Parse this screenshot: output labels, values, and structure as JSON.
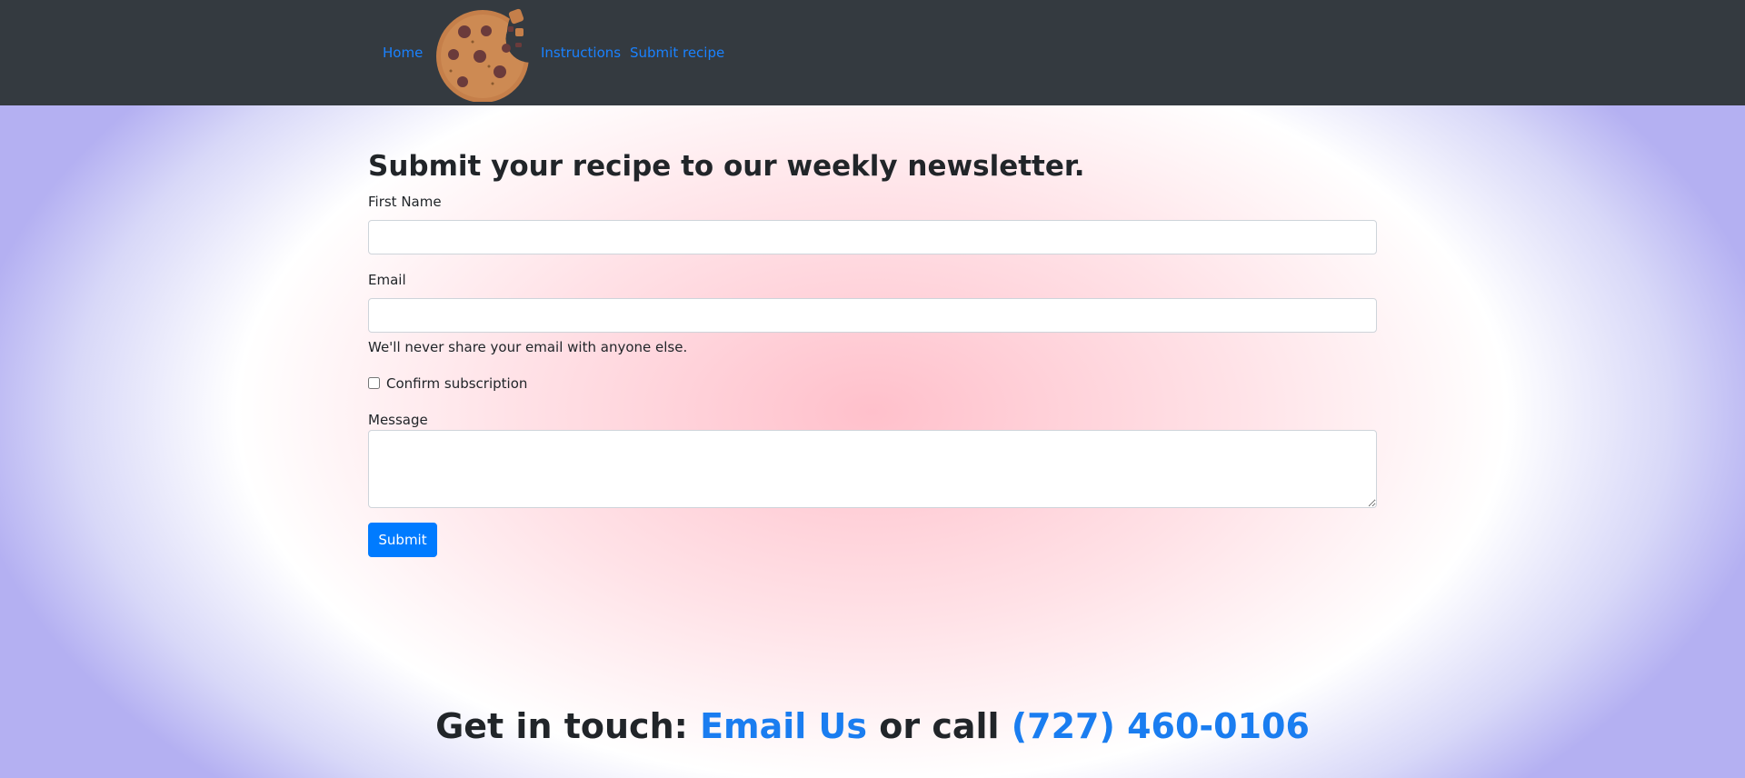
{
  "nav": {
    "items": [
      {
        "label": "Home"
      },
      {
        "label": "Instructions"
      },
      {
        "label": "Submit recipe"
      }
    ],
    "logo_icon": "cookie-icon"
  },
  "form": {
    "title": "Submit your recipe to our weekly newsletter.",
    "first_name_label": "First Name",
    "first_name_value": "",
    "email_label": "Email",
    "email_value": "",
    "email_help": "We'll never share your email with anyone else.",
    "confirm_label": "Confirm subscription",
    "confirm_checked": false,
    "message_label": "Message",
    "message_value": "",
    "submit_label": "Submit"
  },
  "footer": {
    "prefix": "Get in touch: ",
    "email_link": "Email Us",
    "middle": " or call ",
    "phone_link": "(727) 460-0106"
  },
  "colors": {
    "navbar": "#343a40",
    "link": "#1a82ff",
    "primary": "#007bff"
  }
}
